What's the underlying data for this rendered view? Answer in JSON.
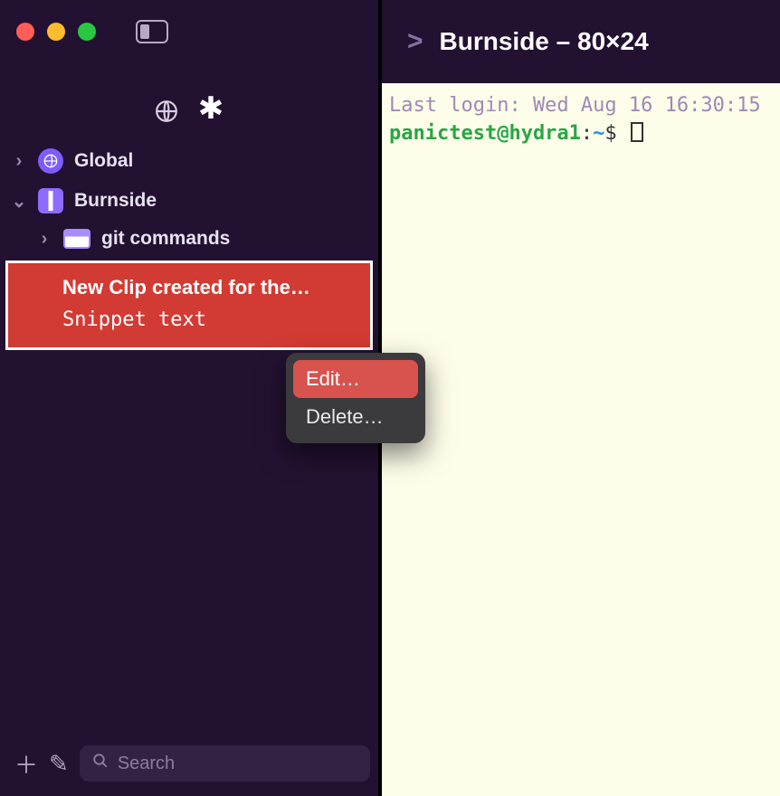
{
  "sidebar": {
    "scope_globe_icon": "globe-icon",
    "scope_asterisk_icon": "asterisk-icon",
    "tree": {
      "global": {
        "label": "Global",
        "expanded": false
      },
      "burnside": {
        "label": "Burnside",
        "expanded": true,
        "children": [
          {
            "kind": "folder",
            "label": "git commands",
            "expanded": false
          }
        ]
      },
      "selected_clip": {
        "title": "New Clip created for the…",
        "body": "Snippet text"
      }
    },
    "bottom": {
      "add_icon": "plus-icon",
      "edit_icon": "pencil-icon",
      "search_placeholder": "Search"
    }
  },
  "context_menu": {
    "items": [
      {
        "label": "Edit…",
        "hover": true
      },
      {
        "label": "Delete…",
        "hover": false
      }
    ]
  },
  "terminal": {
    "tab_title": "Burnside – 80×24",
    "last_login_line": "Last login: Wed Aug 16 16:30:15",
    "prompt_user_host": "panictest@hydra1",
    "prompt_sep": ":",
    "prompt_path": "~",
    "prompt_char": "$"
  }
}
